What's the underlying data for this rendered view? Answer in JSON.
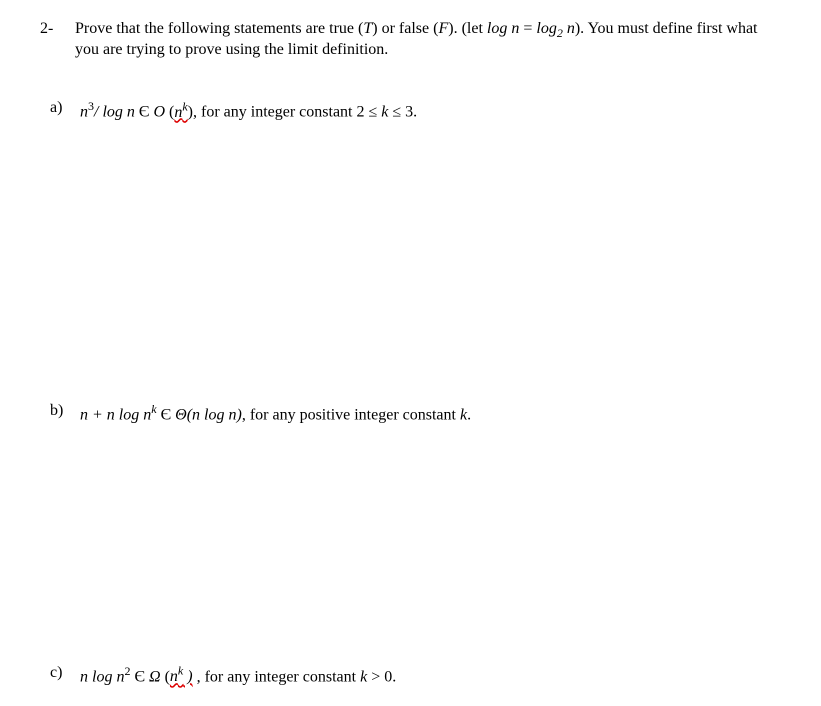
{
  "question": {
    "number": "2-",
    "text_part1": "Prove that the following statements are true (",
    "T": "T",
    "text_part2": ") or false (",
    "F": "F",
    "text_part3": "). (let ",
    "log_n": "log n",
    "eq": " = ",
    "log2n": "log",
    "sub2": "2",
    "log2n_after": " n",
    "text_part4": "). You must define first what you are trying to prove using the limit definition."
  },
  "parts": {
    "a": {
      "label": "a)",
      "expr_pre": "n",
      "sup3": "3",
      "expr_mid": "/ log n ",
      "in": "Є",
      "space": " ",
      "O": "O",
      "paren_open": " (",
      "nk_n": "n",
      "nk_k": "k",
      "paren_close": ")",
      "text": ", for any integer constant 2 ≤ ",
      "k": "k",
      "text2": " ≤ 3."
    },
    "b": {
      "label": "b)",
      "expr1": "n + n log n",
      "supk": "k",
      "in": "  Є ",
      "Theta": "Θ",
      "expr2": "(n log n)",
      "text": ", for any positive integer constant ",
      "k": "k",
      "period": "."
    },
    "c": {
      "label": "c)",
      "expr1": "n log n",
      "sup2": "2",
      "in": "  Є  ",
      "Omega": "Ω",
      "paren_open": " (",
      "nk_n": "n",
      "nk_k": "k",
      "nk_close": " )",
      "text": " ,  for any integer constant ",
      "k": "k",
      "text2": " > 0."
    }
  }
}
